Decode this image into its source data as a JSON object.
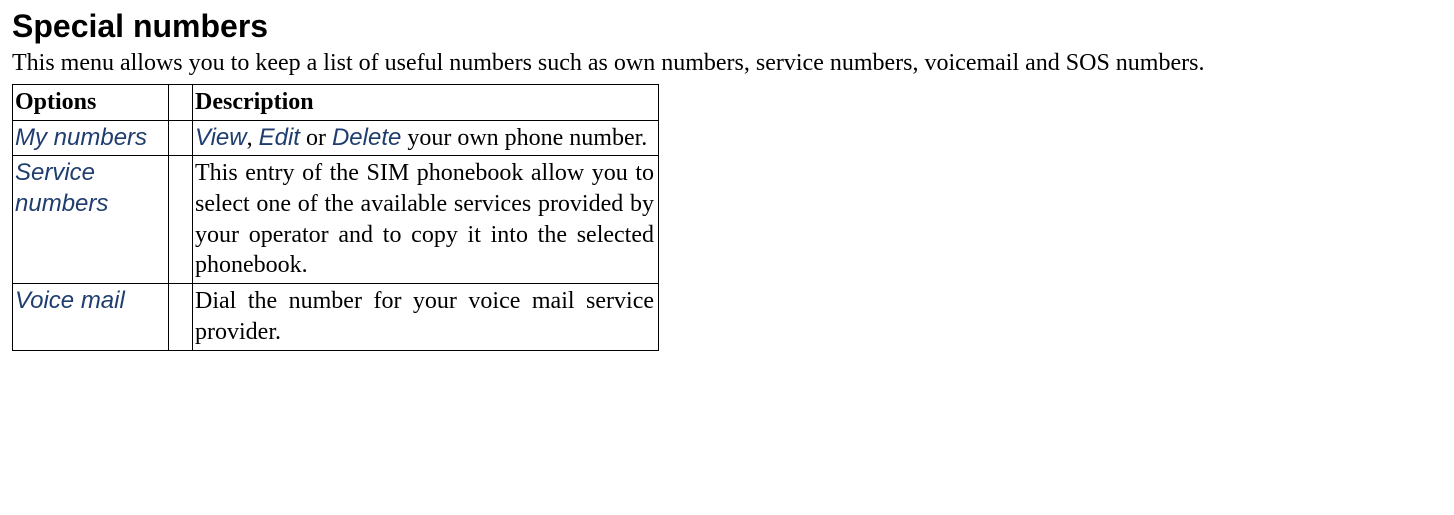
{
  "heading": "Special numbers",
  "intro": "This menu allows you to keep a list of useful numbers such as own numbers, service numbers, voicemail and SOS numbers.",
  "table": {
    "headers": {
      "options": "Options",
      "description": "Description"
    },
    "rows": [
      {
        "option": "My numbers",
        "desc_parts": {
          "view": "View",
          "sep1": ", ",
          "edit": "Edit",
          "sep2": " or ",
          "delete": "Delete",
          "rest": " your own phone number."
        }
      },
      {
        "option": "Service numbers",
        "desc": "This entry of the SIM phonebook allow you to select one of the available services provided by your operator and to copy it into the selected phonebook."
      },
      {
        "option": "Voice mail",
        "desc": "Dial the number for your voice mail service provider."
      }
    ]
  }
}
